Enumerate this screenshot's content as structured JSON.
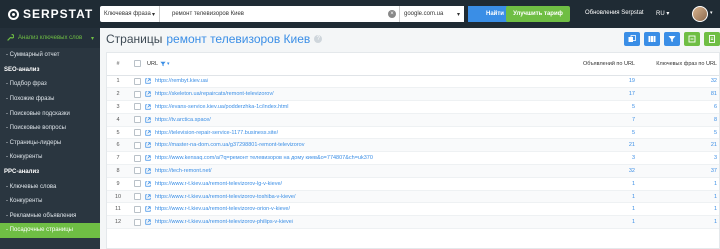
{
  "header": {
    "logo_text": "SERPSTAT",
    "scope_select": "Ключевая фраза",
    "query_value": "ремонт телевизоров Киев",
    "clear_glyph": "×",
    "database_select": "google.com.ua",
    "find_button": "Найти",
    "upgrade_button": "Улучшить тариф",
    "updates_link": "Обновления Serpstat",
    "language": "RU",
    "caret": "▾"
  },
  "sidebar": {
    "header_label": "Анализ ключевых слов",
    "header_chevron": "▾",
    "items": [
      {
        "label": "- Суммарный отчет",
        "type": "item"
      },
      {
        "label": "SEO-анализ",
        "type": "section"
      },
      {
        "label": "- Подбор фраз",
        "type": "item"
      },
      {
        "label": "- Похожие фразы",
        "type": "item"
      },
      {
        "label": "- Поисковые подсказки",
        "type": "item"
      },
      {
        "label": "- Поисковые вопросы",
        "type": "item"
      },
      {
        "label": "- Страницы-лидеры",
        "type": "item"
      },
      {
        "label": "- Конкуренты",
        "type": "item"
      },
      {
        "label": "PPC-анализ",
        "type": "section"
      },
      {
        "label": "- Ключевые слова",
        "type": "item"
      },
      {
        "label": "- Конкуренты",
        "type": "item"
      },
      {
        "label": "- Рекламные объявления",
        "type": "item"
      },
      {
        "label": "- Посадочные страницы",
        "type": "active"
      }
    ]
  },
  "page": {
    "title": "Страницы",
    "title_query": "ремонт телевизоров Киев",
    "help_glyph": "?"
  },
  "table": {
    "columns": {
      "num": "#",
      "url": "URL",
      "ads": "Объявлений по URL",
      "keywords": "Ключевых фраз по URL"
    },
    "rows": [
      {
        "num": "1",
        "url": "https://rembyt.kiev.ua/",
        "ads": "19",
        "keywords": "32"
      },
      {
        "num": "2",
        "url": "https://skeleton.ua/repaircats/remont-televizorov/",
        "ads": "17",
        "keywords": "81"
      },
      {
        "num": "3",
        "url": "https://evans-service.kiev.ua/podderzhka-1c/index.html",
        "ads": "5",
        "keywords": "6"
      },
      {
        "num": "4",
        "url": "https://tv.arctica.space/",
        "ads": "7",
        "keywords": "8"
      },
      {
        "num": "5",
        "url": "https://television-repair-service-1177.business.site/",
        "ads": "5",
        "keywords": "5"
      },
      {
        "num": "6",
        "url": "https://master-na-dom.com.ua/g37298801-remont-televizorov",
        "ads": "21",
        "keywords": "21"
      },
      {
        "num": "7",
        "url": "https://www.kensaq.com/a/?q=ремонт телевизоров на дому киев&o=774807&ch=uk370",
        "ads": "3",
        "keywords": "3"
      },
      {
        "num": "8",
        "url": "https://tech-remont.net/",
        "ads": "32",
        "keywords": "37"
      },
      {
        "num": "9",
        "url": "https://www.r-t.kiev.ua/remont-televizorov-lg-v-kieve/",
        "ads": "1",
        "keywords": "1"
      },
      {
        "num": "10",
        "url": "https://www.r-t.kiev.ua/remont-televizorov-toshiba-v-kieve/",
        "ads": "1",
        "keywords": "1"
      },
      {
        "num": "11",
        "url": "https://www.r-t.kiev.ua/remont-televizorov-orion-v-kieve/",
        "ads": "1",
        "keywords": "1"
      },
      {
        "num": "12",
        "url": "https://www.r-t.kiev.ua/remont-televizorov-philips-v-kieve/",
        "ads": "1",
        "keywords": "1"
      }
    ]
  },
  "colors": {
    "topbar": "#1f2b34",
    "sidebar": "#2a3640",
    "accent_green": "#6fbe44",
    "link_blue": "#3a8ee6"
  }
}
